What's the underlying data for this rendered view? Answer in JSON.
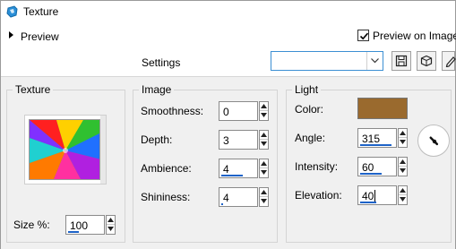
{
  "window": {
    "title": "Texture"
  },
  "preview": {
    "label": "Preview",
    "preview_on_image_label": "Preview on Image",
    "preview_on_image_checked": true
  },
  "settings": {
    "label": "Settings",
    "selected_value": ""
  },
  "toolbar": {
    "buttons": [
      "save-icon",
      "presets-icon",
      "edit-icon"
    ]
  },
  "texture_group": {
    "title": "Texture",
    "size_label": "Size %:",
    "size_value": "100",
    "size_fraction": 0.3
  },
  "image_group": {
    "title": "Image",
    "fields": [
      {
        "label": "Smoothness:",
        "value": "0",
        "fraction": 0.0
      },
      {
        "label": "Depth:",
        "value": "3",
        "fraction": 0.0
      },
      {
        "label": "Ambience:",
        "value": "4",
        "fraction": 0.6
      },
      {
        "label": "Shininess:",
        "value": "4",
        "fraction": 0.05
      }
    ]
  },
  "light_group": {
    "title": "Light",
    "color_label": "Color:",
    "color_value": "#9a6a2e",
    "fields": [
      {
        "label": "Angle:",
        "value": "315",
        "fraction": 0.87
      },
      {
        "label": "Intensity:",
        "value": "60",
        "fraction": 0.6
      },
      {
        "label": "Elevation:",
        "value": "40",
        "fraction": 0.45
      }
    ],
    "angle_dial_degrees": 315
  },
  "colors": {
    "accent": "#1e63c8",
    "panel_bg": "#f0f0f0",
    "select_border": "#3c8fd3"
  }
}
